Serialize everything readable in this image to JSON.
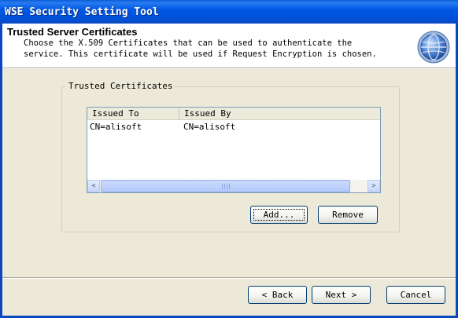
{
  "window": {
    "title": "WSE Security Setting Tool"
  },
  "header": {
    "title": "Trusted Server Certificates",
    "description": "Choose the X.509 Certificates that can be used to authenticate the\nservice. This certificate will be used if Request Encryption is chosen.",
    "icon": "globe-icon"
  },
  "group": {
    "label": "Trusted Certificates"
  },
  "list": {
    "columns": [
      "Issued To",
      "Issued By"
    ],
    "rows": [
      {
        "issued_to": "CN=alisoft",
        "issued_by": "CN=alisoft"
      }
    ],
    "scroll_left": "<",
    "scroll_right": ">",
    "scroll_grip": "III"
  },
  "buttons": {
    "add": "Add...",
    "remove": "Remove",
    "back": "< Back",
    "next": "Next >",
    "cancel": "Cancel"
  },
  "colors": {
    "titlebar": "#0058e6",
    "face": "#ece9d8",
    "border": "#003c74"
  }
}
